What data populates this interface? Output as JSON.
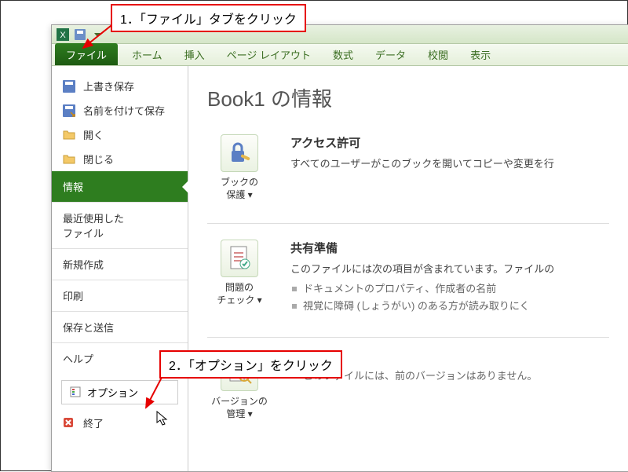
{
  "callouts": {
    "c1": "1．「ファイル」タブをクリック",
    "c2": "2．「オプション」をクリック"
  },
  "ribbon": {
    "file": "ファイル",
    "home": "ホーム",
    "insert": "挿入",
    "layout": "ページ レイアウト",
    "formulas": "数式",
    "data": "データ",
    "review": "校閲",
    "view": "表示"
  },
  "sidebar": {
    "save": "上書き保存",
    "save_as": "名前を付けて保存",
    "open": "開く",
    "close": "閉じる",
    "info": "情報",
    "recent": "最近使用した\nファイル",
    "new": "新規作成",
    "print": "印刷",
    "save_send": "保存と送信",
    "help": "ヘルプ",
    "options": "オプション",
    "exit": "終了"
  },
  "content": {
    "title": "Book1 の情報",
    "perm": {
      "btn": "ブックの\n保護 ▾",
      "title": "アクセス許可",
      "desc": "すべてのユーザーがこのブックを開いてコピーや変更を行"
    },
    "prep": {
      "btn": "問題の\nチェック ▾",
      "title": "共有準備",
      "desc": "このファイルには次の項目が含まれています。ファイルの",
      "li1": "ドキュメントのプロパティ、作成者の名前",
      "li2": "視覚に障碍 (しょうがい) のある方が読み取りにく"
    },
    "ver": {
      "btn": "バージョンの\n管理 ▾",
      "li1": "このファイルには、前のバージョンはありません。"
    }
  }
}
